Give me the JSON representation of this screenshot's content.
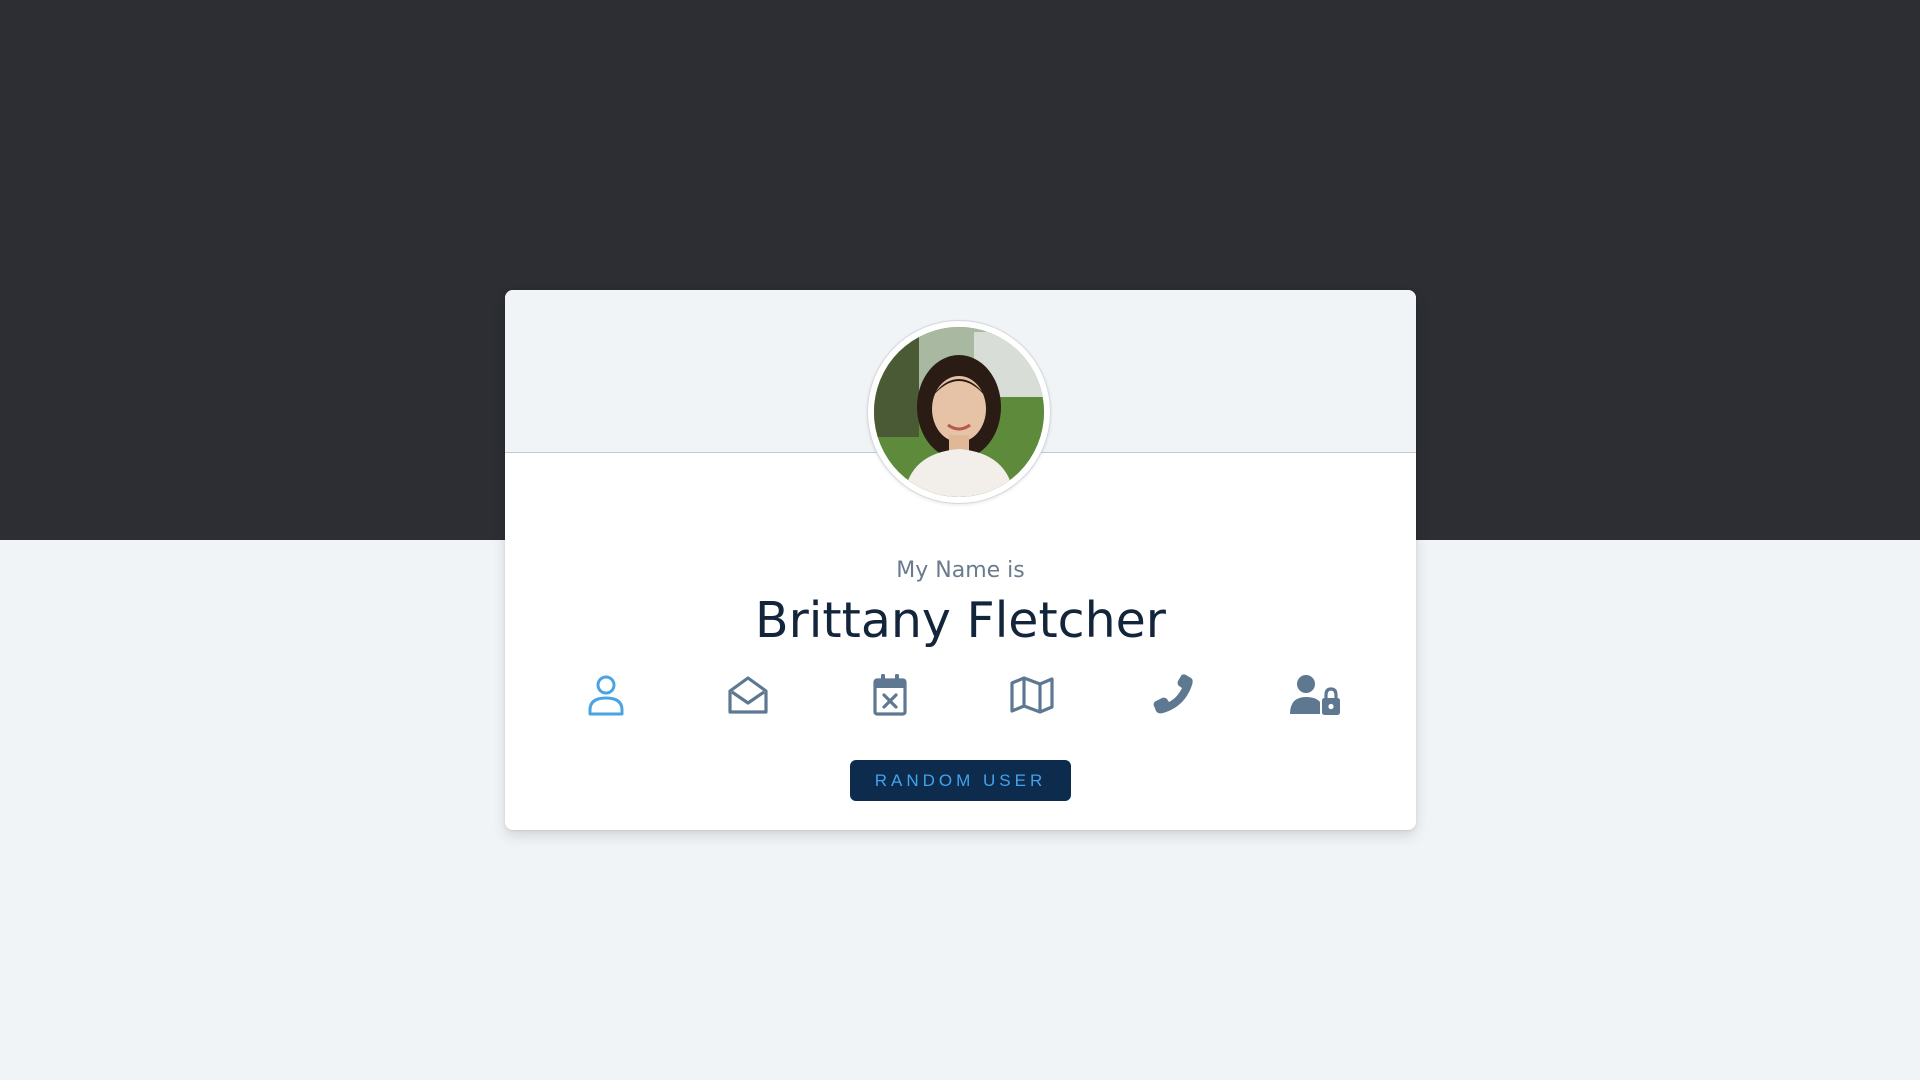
{
  "profile": {
    "label": "My Name is",
    "value": "Brittany Fletcher"
  },
  "icon_tabs": [
    {
      "icon": "user-icon",
      "active": true
    },
    {
      "icon": "envelope-open-icon",
      "active": false
    },
    {
      "icon": "calendar-x-icon",
      "active": false
    },
    {
      "icon": "map-icon",
      "active": false
    },
    {
      "icon": "phone-icon",
      "active": false
    },
    {
      "icon": "user-lock-icon",
      "active": false
    }
  ],
  "actions": {
    "random_label": "RANDOM USER"
  },
  "colors": {
    "dark_band": "#2c2e33",
    "page_bg": "#f1f4f7",
    "active_icon": "#4ba3e3",
    "inactive_icon": "#5e7892",
    "name_text": "#13253b",
    "button_bg": "#0d2c4d",
    "button_text": "#41a2ee"
  }
}
